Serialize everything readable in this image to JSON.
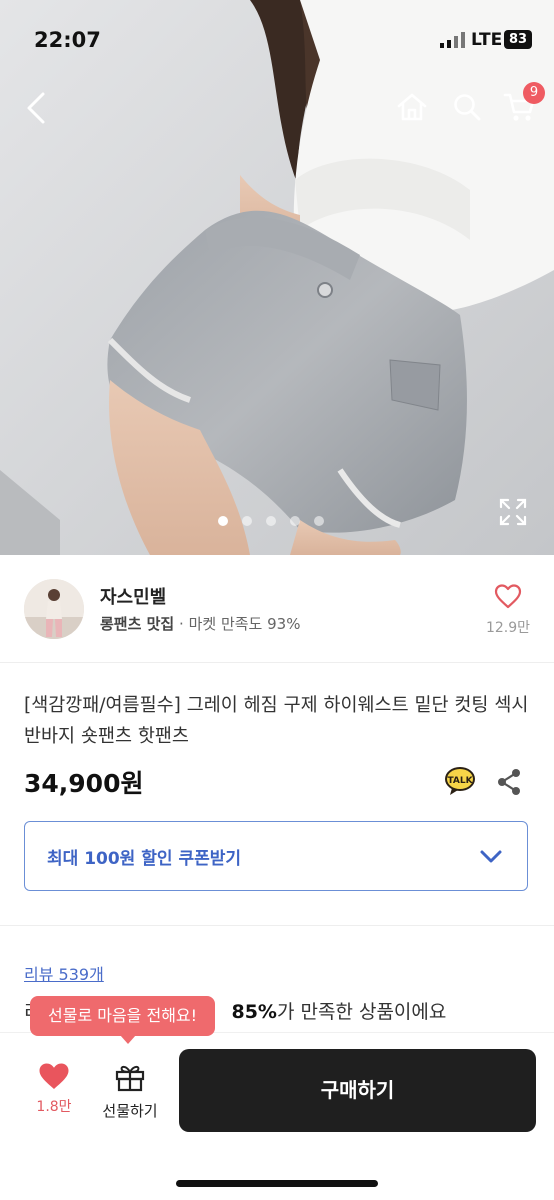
{
  "status": {
    "time": "22:07",
    "network": "LTE",
    "battery": "83"
  },
  "header": {
    "cart_count": "9"
  },
  "gallery": {
    "slide_count": 5,
    "active_index": 0
  },
  "seller": {
    "name": "자스민벨",
    "tagline": "롱팬츠 맛집",
    "separator": "·",
    "satisfaction": "마켓 만족도 93%",
    "likes": "12.9만"
  },
  "product": {
    "title": "[색감깡패/여름필수] 그레이 헤짐 구제 하이웨스트 밑단 컷팅 섹시 반바지 숏팬츠 핫팬츠",
    "price": "34,900원",
    "talk_badge": "TALK"
  },
  "coupon": {
    "label": "최대 100원 할인 쿠폰받기"
  },
  "reviews": {
    "link": "리뷰 539개",
    "summary_prefix": "리",
    "summary_percent": "85%",
    "summary_suffix": "가 만족한 상품이에요"
  },
  "bottom": {
    "tooltip": "선물로 마음을 전해요!",
    "wish_count": "1.8만",
    "gift_label": "선물하기",
    "buy_label": "구매하기"
  },
  "colors": {
    "accent_red": "#ef6a6d",
    "link_blue": "#4a6cc9",
    "buy_bg": "#1f1f1f"
  }
}
